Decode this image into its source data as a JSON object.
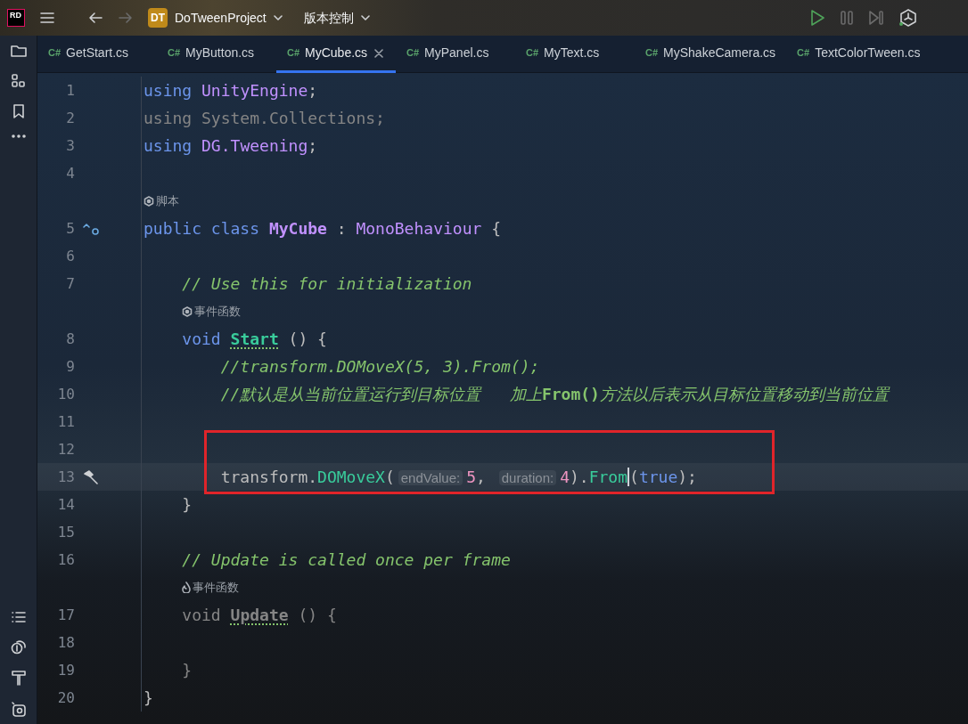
{
  "title_bar": {
    "logo": "RD",
    "project_badge": "DT",
    "project_name": "DoTweenProject",
    "vcs_menu": "版本控制"
  },
  "tabs": [
    {
      "type_label": "C#",
      "label": "GetStart.cs",
      "selected": false
    },
    {
      "type_label": "C#",
      "label": "MyButton.cs",
      "selected": false
    },
    {
      "type_label": "C#",
      "label": "MyCube.cs",
      "selected": true
    },
    {
      "type_label": "C#",
      "label": "MyPanel.cs",
      "selected": false
    },
    {
      "type_label": "C#",
      "label": "MyText.cs",
      "selected": false
    },
    {
      "type_label": "C#",
      "label": "MyShakeCamera.cs",
      "selected": false
    },
    {
      "type_label": "C#",
      "label": "TextColorTween.cs",
      "selected": false
    }
  ],
  "editor": {
    "rows": [
      {
        "kind": "code",
        "number": "1",
        "tokens": [
          {
            "kind": "kw",
            "text": "using "
          },
          {
            "kind": "type",
            "text": "UnityEngine"
          },
          {
            "kind": "punct",
            "text": ";"
          }
        ]
      },
      {
        "kind": "code",
        "number": "2",
        "tokens": [
          {
            "kind": "dim",
            "text": "using System.Collections;"
          }
        ]
      },
      {
        "kind": "code",
        "number": "3",
        "tokens": [
          {
            "kind": "kw",
            "text": "using "
          },
          {
            "kind": "type",
            "text": "DG.Tweening"
          },
          {
            "kind": "punct",
            "text": ";"
          }
        ]
      },
      {
        "kind": "code",
        "number": "4",
        "tokens": []
      },
      {
        "kind": "unitylens",
        "nested": false,
        "text": "脚本"
      },
      {
        "kind": "classdecl",
        "number": "5",
        "tokens": [
          {
            "kind": "kw",
            "text": "public class "
          },
          {
            "kind": "type",
            "text": "MyCube",
            "bold": true
          },
          {
            "kind": "punct",
            "text": " : "
          },
          {
            "kind": "type",
            "text": "MonoBehaviour"
          },
          {
            "kind": "punct",
            "text": " {"
          }
        ]
      },
      {
        "kind": "code",
        "number": "6",
        "tokens": []
      },
      {
        "kind": "code",
        "number": "7",
        "tokens": [
          {
            "kind": "comment",
            "text": "    // Use this for initialization"
          }
        ]
      },
      {
        "kind": "unitylens",
        "nested": true,
        "text": "事件函数"
      },
      {
        "kind": "code",
        "number": "8",
        "tokens": [
          {
            "kind": "kw",
            "text": "    void "
          },
          {
            "kind": "method",
            "text": "Start",
            "bold": true,
            "squiggle": true
          },
          {
            "kind": "punct",
            "text": " () {"
          }
        ]
      },
      {
        "kind": "code",
        "number": "9",
        "tokens": [
          {
            "kind": "comment",
            "text": "        //transform.DOMoveX(5, 3).From();"
          }
        ]
      },
      {
        "kind": "code",
        "number": "10",
        "tokens": [
          {
            "kind": "comment",
            "text": "        //默认是从当前位置运行到目标位置   加上"
          },
          {
            "kind": "comment_bold",
            "text": "From()"
          },
          {
            "kind": "comment",
            "text": "方法以后表示从目标位置移动到当前位置"
          }
        ]
      },
      {
        "kind": "code",
        "number": "11",
        "tokens": []
      },
      {
        "kind": "code",
        "number": "12",
        "boxed": true,
        "tokens": []
      },
      {
        "kind": "edited",
        "number": "13",
        "boxed": true,
        "current": true,
        "tokens": [
          {
            "kind": "plain",
            "text": "        transform."
          },
          {
            "kind": "method",
            "text": "DOMoveX"
          },
          {
            "kind": "punct",
            "text": "("
          },
          {
            "kind": "hint",
            "text": "endValue:"
          },
          {
            "kind": "number",
            "text": "5"
          },
          {
            "kind": "punct",
            "text": ", "
          },
          {
            "kind": "hint",
            "text": "duration:"
          },
          {
            "kind": "number",
            "text": "4"
          },
          {
            "kind": "punct",
            "text": ")."
          },
          {
            "kind": "method",
            "text": "From",
            "caret": true
          },
          {
            "kind": "punct",
            "text": "("
          },
          {
            "kind": "kw",
            "text": "true"
          },
          {
            "kind": "punct",
            "text": ");"
          }
        ]
      },
      {
        "kind": "code",
        "number": "14",
        "tokens": [
          {
            "kind": "punct",
            "text": "    }"
          }
        ]
      },
      {
        "kind": "code",
        "number": "15",
        "tokens": []
      },
      {
        "kind": "code",
        "number": "16",
        "tokens": [
          {
            "kind": "comment",
            "text": "    // Update is called once per frame"
          }
        ]
      },
      {
        "kind": "hotlens",
        "nested": true,
        "text": "事件函数"
      },
      {
        "kind": "code",
        "number": "17",
        "tokens": [
          {
            "kind": "dim",
            "text": "    void "
          },
          {
            "kind": "dim",
            "text": "Update",
            "bold": true,
            "squiggle": true
          },
          {
            "kind": "dim",
            "text": " () {"
          }
        ]
      },
      {
        "kind": "code",
        "number": "18",
        "tokens": []
      },
      {
        "kind": "code",
        "number": "19",
        "tokens": [
          {
            "kind": "dim",
            "text": "    }"
          }
        ]
      },
      {
        "kind": "code",
        "number": "20",
        "tokens": [
          {
            "kind": "punct",
            "text": "}"
          }
        ]
      }
    ]
  }
}
